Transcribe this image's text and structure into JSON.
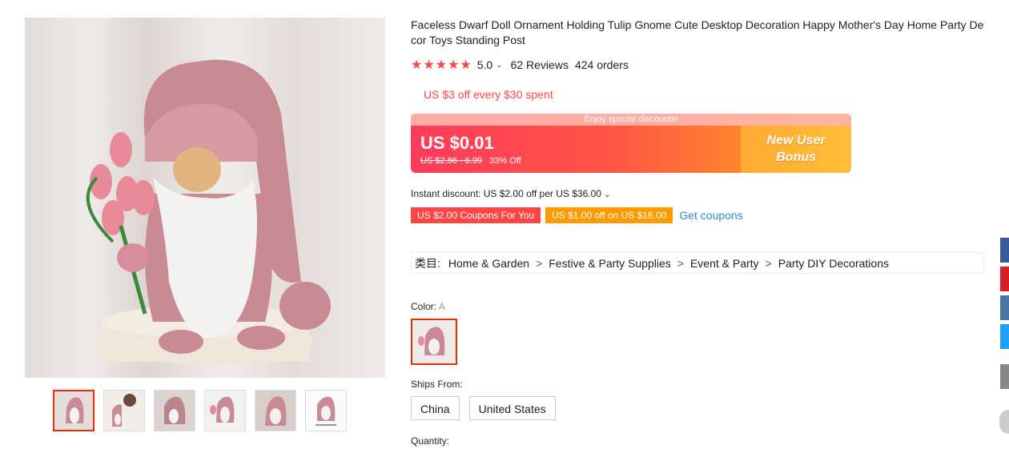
{
  "product": {
    "title": "Faceless Dwarf Doll Ornament Holding Tulip Gnome Cute Desktop Decoration Happy Mother's Day Home Party Decor Toys Standing Post",
    "stars": "★★★★★",
    "rating": "5.0",
    "reviews": "62 Reviews",
    "orders": "424 orders"
  },
  "promo": {
    "store_discount": "US $3 off every $30 spent"
  },
  "price": {
    "banner": "Enjoy special discounts!",
    "current": "US $0.01",
    "original": "US $2.86 - 6.99",
    "discount": "33% Off",
    "bonus_line1": "New User",
    "bonus_line2": "Bonus"
  },
  "instant_discount": "Instant discount: US $2.00 off per US $36.00",
  "coupons": [
    {
      "label": "US $2.00 Coupons For You"
    },
    {
      "label": "US $1.00 off on US $16.00"
    }
  ],
  "get_coupons": "Get coupons",
  "breadcrumb": {
    "label": "类目:",
    "items": [
      "Home & Garden",
      "Festive & Party Supplies",
      "Event & Party",
      "Party DIY Decorations"
    ]
  },
  "color": {
    "label": "Color:",
    "value": "A"
  },
  "ships_from": {
    "label": "Ships From:",
    "options": [
      "China",
      "United States"
    ]
  },
  "quantity": {
    "label": "Quantity:"
  },
  "colors": {
    "accent": "#e62e04",
    "price_start": "#ff3b5c",
    "price_end": "#ffb334",
    "link": "#2b8cc4"
  },
  "share_icons": [
    "facebook-icon",
    "pinterest-icon",
    "vk-icon",
    "twitter-icon",
    "email-icon",
    "more-icon"
  ]
}
